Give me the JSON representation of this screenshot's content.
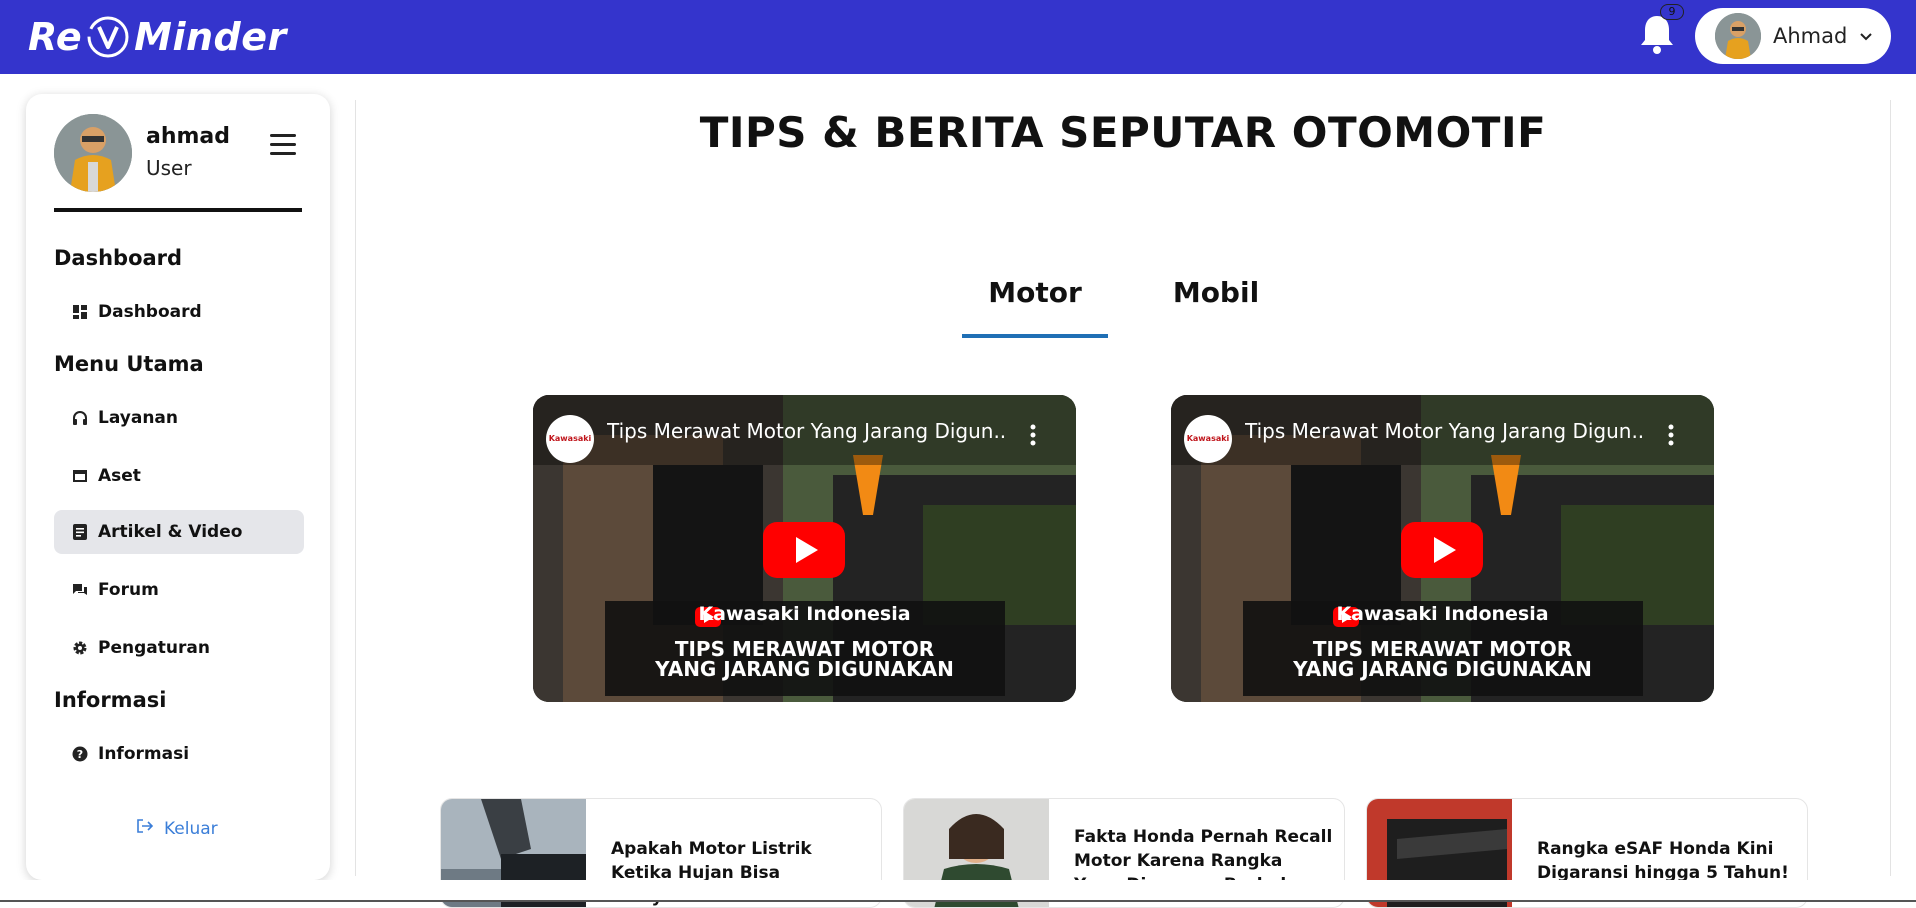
{
  "app": {
    "logo_left": "Re",
    "logo_right": "Minder",
    "notification_count": "9",
    "user_name": "Ahmad"
  },
  "sidebar": {
    "profile_name": "ahmad",
    "profile_role": "User",
    "sections": [
      {
        "title": "Dashboard",
        "items": [
          {
            "label": "Dashboard",
            "icon": "dashboard-icon"
          }
        ]
      },
      {
        "title": "Menu Utama",
        "items": [
          {
            "label": "Layanan",
            "icon": "headphones-icon"
          },
          {
            "label": "Aset",
            "icon": "window-icon"
          },
          {
            "label": "Artikel & Video",
            "icon": "article-icon",
            "active": true
          },
          {
            "label": "Forum",
            "icon": "chat-icon"
          },
          {
            "label": "Pengaturan",
            "icon": "gear-icon"
          }
        ]
      },
      {
        "title": "Informasi",
        "items": [
          {
            "label": "Informasi",
            "icon": "question-icon"
          }
        ]
      }
    ],
    "logout_label": "Keluar"
  },
  "main": {
    "title": "TIPS & BERITA SEPUTAR OTOMOTIF",
    "tabs": [
      {
        "label": "Motor",
        "active": true
      },
      {
        "label": "Mobil",
        "active": false
      }
    ],
    "videos": [
      {
        "title": "Tips Merawat Motor Yang Jarang Digun...",
        "channel": "Kawasaki Indonesia",
        "caption_line1": "TIPS MERAWAT MOTOR",
        "caption_line2": "YANG JARANG DIGUNAKAN",
        "logo_text": "Kawasaki"
      },
      {
        "title": "Tips Merawat Motor Yang Jarang Digun...",
        "channel": "Kawasaki Indonesia",
        "caption_line1": "TIPS MERAWAT MOTOR",
        "caption_line2": "YANG JARANG DIGUNAKAN",
        "logo_text": "Kawasaki"
      }
    ],
    "articles": [
      {
        "title": "Apakah Motor Listrik Ketika Hujan Bisa Menyetrum?"
      },
      {
        "title": "Fakta Honda Pernah Recall Motor Karena Rangka Yang Dianggap Berbahaya"
      },
      {
        "title": "Rangka eSAF Honda Kini Digaransi hingga 5 Tahun!"
      }
    ]
  },
  "colors": {
    "topbar": "#3434cc",
    "tab_underline": "#1f6fb5",
    "logout": "#3b7ed8",
    "active_nav_bg": "#e5e6ea",
    "youtube_red": "#ff0000"
  }
}
